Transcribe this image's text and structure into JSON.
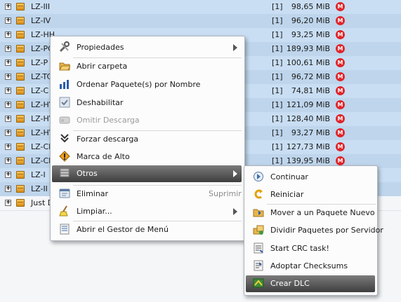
{
  "rows": [
    {
      "name": "LZ-III",
      "prio": "[1]",
      "size": "98,65 MiB",
      "host": "M",
      "selected": true
    },
    {
      "name": "LZ-IV",
      "prio": "[1]",
      "size": "96,20 MiB",
      "host": "M",
      "selected": true
    },
    {
      "name": "LZ-HH",
      "prio": "[1]",
      "size": "93,25 MiB",
      "host": "M",
      "selected": true
    },
    {
      "name": "LZ-PC",
      "prio": "[1]",
      "size": "189,93 MiB",
      "host": "M",
      "selected": true
    },
    {
      "name": "LZ-P",
      "prio": "[1]",
      "size": "100,61 MiB",
      "host": "M",
      "selected": true
    },
    {
      "name": "LZ-TC",
      "prio": "[1]",
      "size": "96,72 MiB",
      "host": "M",
      "selected": true
    },
    {
      "name": "LZ-C",
      "prio": "[1]",
      "size": "74,81 MiB",
      "host": "M",
      "selected": true
    },
    {
      "name": "LZ-HV",
      "prio": "[1]",
      "size": "121,09 MiB",
      "host": "M",
      "selected": true
    },
    {
      "name": "LZ-HV",
      "prio": "[1]",
      "size": "128,40 MiB",
      "host": "M",
      "selected": true
    },
    {
      "name": "LZ-HV",
      "prio": "[1]",
      "size": "93,27 MiB",
      "host": "M",
      "selected": true
    },
    {
      "name": "LZ-CD",
      "prio": "[1]",
      "size": "127,73 MiB",
      "host": "M",
      "selected": true
    },
    {
      "name": "LZ-CD",
      "prio": "[1]",
      "size": "139,95 MiB",
      "host": "M",
      "selected": true
    },
    {
      "name": "LZ-I",
      "prio": "",
      "size": "",
      "host": "",
      "selected": true
    },
    {
      "name": "LZ-II",
      "prio": "",
      "size": "",
      "host": "",
      "selected": true
    },
    {
      "name": "Just D",
      "prio": "",
      "size": "",
      "host": "",
      "selected": false
    }
  ],
  "context_menu": {
    "items": [
      {
        "label": "Propiedades",
        "icon": "tools-icon",
        "submenu": true
      },
      {
        "label": "Abrir carpeta",
        "icon": "open-folder-icon"
      },
      {
        "label": "Ordenar Paquete(s) por Nombre",
        "icon": "sort-icon"
      },
      {
        "label": "Deshabilitar",
        "icon": "disable-icon"
      },
      {
        "label": "Omitir Descarga",
        "icon": "skip-icon",
        "disabled": true
      },
      {
        "label": "Forzar descarga",
        "icon": "force-download-icon"
      },
      {
        "label": "Marca de Alto",
        "icon": "stop-mark-icon"
      },
      {
        "label": "Otros",
        "icon": "others-icon",
        "submenu": true,
        "highlighted": true
      },
      {
        "label": "Eliminar",
        "icon": "delete-icon",
        "shortcut": "Suprimir"
      },
      {
        "label": "Limpiar...",
        "icon": "clean-icon",
        "submenu": true
      },
      {
        "label": "Abrir el Gestor de Menú",
        "icon": "menu-manager-icon"
      }
    ]
  },
  "submenu": {
    "items": [
      {
        "label": "Continuar",
        "icon": "continue-icon"
      },
      {
        "label": "Reiniciar",
        "icon": "restart-icon"
      },
      {
        "label": "Mover a un Paquete Nuevo",
        "icon": "move-package-icon"
      },
      {
        "label": "Dividir Paquetes por Servidor",
        "icon": "split-package-icon"
      },
      {
        "label": "Start CRC task!",
        "icon": "crc-icon"
      },
      {
        "label": "Adoptar Checksums",
        "icon": "checksum-icon"
      },
      {
        "label": "Crear DLC",
        "icon": "dlc-icon",
        "highlighted": true
      }
    ]
  },
  "colors": {
    "selection": "#c9def3",
    "highlight": "#4a4a4a",
    "host_badge": "#e0252a"
  }
}
